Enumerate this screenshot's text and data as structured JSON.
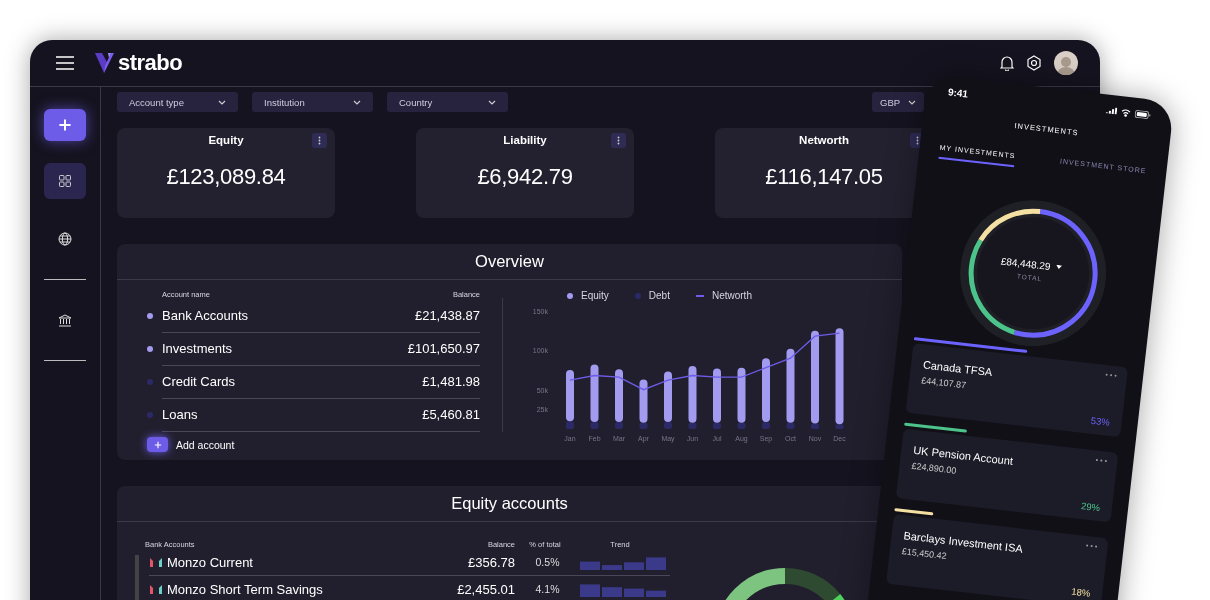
{
  "app": {
    "name": "strabo"
  },
  "sidebar": {
    "items": [
      {
        "kind": "dashboard",
        "selected": true
      },
      {
        "kind": "globe",
        "selected": false
      },
      {
        "kind": "bank",
        "selected": false
      }
    ]
  },
  "filters": [
    "Account type",
    "Institution",
    "Country"
  ],
  "currency": "GBP",
  "stats": [
    {
      "title": "Equity",
      "value": "£123,089.84"
    },
    {
      "title": "Liability",
      "value": "£6,942.79"
    },
    {
      "title": "Networth",
      "value": "£116,147.05"
    }
  ],
  "overview": {
    "title": "Overview",
    "columns": [
      "Account name",
      "Balance"
    ],
    "rows": [
      {
        "name": "Bank Accounts",
        "balance": "£21,438.87",
        "color": "#a29bef"
      },
      {
        "name": "Investments",
        "balance": "£101,650.97",
        "color": "#a29bef"
      },
      {
        "name": "Credit Cards",
        "balance": "£1,481.98",
        "color": "#2c2a66"
      },
      {
        "name": "Loans",
        "balance": "£5,460.81",
        "color": "#2c2a66"
      }
    ],
    "add_label": "Add account",
    "chart_data": {
      "type": "bar",
      "stacked": true,
      "categories": [
        "Jan",
        "Feb",
        "Mar",
        "Apr",
        "May",
        "Jun",
        "Jul",
        "Aug",
        "Sep",
        "Oct",
        "Nov",
        "Dec"
      ],
      "ylim": [
        0,
        150000
      ],
      "yticks": [
        {
          "value": 25000,
          "label": "25k"
        },
        {
          "value": 50000,
          "label": "50k"
        },
        {
          "value": 100000,
          "label": "100k"
        },
        {
          "value": 150000,
          "label": "150k"
        }
      ],
      "series": [
        {
          "name": "Equity",
          "type": "bar",
          "color": "#a29bef",
          "values": [
            65000,
            73000,
            67000,
            55000,
            64000,
            72000,
            69000,
            70000,
            81000,
            94000,
            118000,
            122000
          ]
        },
        {
          "name": "Debt",
          "type": "bar",
          "color": "#2c2a66",
          "values": [
            10000,
            9000,
            9000,
            8000,
            9000,
            8000,
            8000,
            8000,
            9000,
            8000,
            7000,
            6000
          ]
        },
        {
          "name": "Networth",
          "type": "line",
          "color": "#6c5ce7",
          "values": [
            62000,
            68000,
            66000,
            50000,
            62000,
            68000,
            66000,
            66000,
            78000,
            90000,
            118000,
            122000
          ]
        }
      ]
    }
  },
  "equity_accounts": {
    "title": "Equity accounts",
    "columns": [
      "Bank Accounts",
      "Balance",
      "% of total",
      "Trend"
    ],
    "rows": [
      {
        "name": "Monzo Current",
        "balance": "£356.78",
        "share": "0.5%"
      },
      {
        "name": "Monzo Short Term Savings",
        "balance": "£2,455.01",
        "share": "4.1%"
      }
    ]
  },
  "phone": {
    "time": "9:41",
    "title": "INVESTMENTS",
    "tabs": [
      {
        "label": "MY INVESTMENTS",
        "selected": true
      },
      {
        "label": "INVESTMENT STORE",
        "selected": false
      }
    ],
    "total": "£84,448.29",
    "total_label": "TOTAL",
    "investments": [
      {
        "name": "Canada TFSA",
        "amount": "£44,107.87",
        "share": "53%",
        "color": "#6c63ff",
        "level": 0.53
      },
      {
        "name": "UK Pension Account",
        "amount": "£24,890.00",
        "share": "29%",
        "color": "#4cc38a",
        "level": 0.29
      },
      {
        "name": "Barclays Investment ISA",
        "amount": "£15,450.42",
        "share": "18%",
        "color": "#f5e0a3",
        "level": 0.18
      }
    ]
  }
}
